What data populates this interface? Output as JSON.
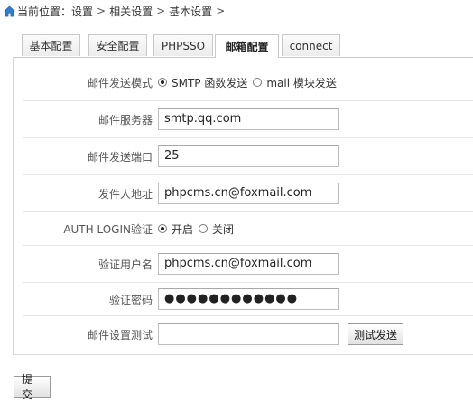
{
  "breadcrumb": {
    "prefix": "当前位置：",
    "items": [
      "设置",
      "相关设置",
      "基本设置"
    ],
    "separator": ">"
  },
  "tabs": [
    {
      "label": "基本配置",
      "active": false
    },
    {
      "label": "安全配置",
      "active": false
    },
    {
      "label": "PHPSSO",
      "active": false
    },
    {
      "label": "邮箱配置",
      "active": true
    },
    {
      "label": "connect",
      "active": false
    }
  ],
  "form": {
    "mail_mode": {
      "label": "邮件发送模式",
      "options": [
        {
          "label": "SMTP 函数发送",
          "checked": true
        },
        {
          "label": "mail 模块发送",
          "checked": false
        }
      ]
    },
    "mail_server": {
      "label": "邮件服务器",
      "value": "smtp.qq.com"
    },
    "mail_port": {
      "label": "邮件发送端口",
      "value": "25"
    },
    "sender_address": {
      "label": "发件人地址",
      "value": "phpcms.cn@foxmail.com"
    },
    "auth_login": {
      "label": "AUTH LOGIN验证",
      "options": [
        {
          "label": "开启",
          "checked": true
        },
        {
          "label": "关闭",
          "checked": false
        }
      ]
    },
    "auth_username": {
      "label": "验证用户名",
      "value": "phpcms.cn@foxmail.com"
    },
    "auth_password": {
      "label": "验证密码",
      "value": "●●●●●●●●●●●●"
    },
    "mail_test": {
      "label": "邮件设置测试",
      "value": "",
      "button_label": "测试发送"
    }
  },
  "submit_label": "提交"
}
